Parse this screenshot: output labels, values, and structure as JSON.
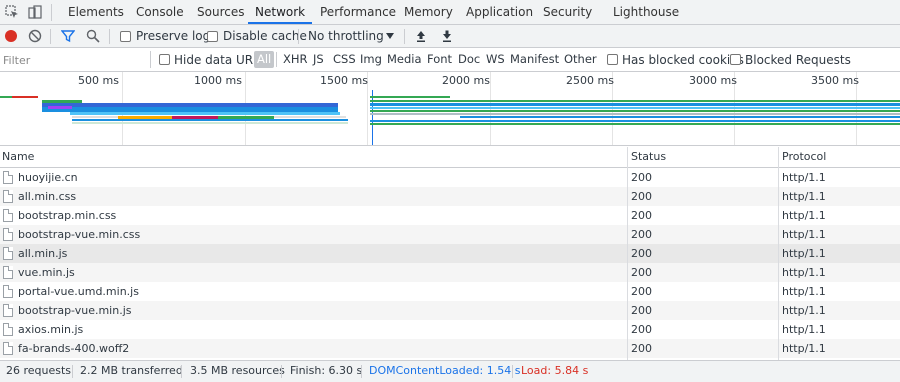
{
  "tabs": [
    "Elements",
    "Console",
    "Sources",
    "Network",
    "Performance",
    "Memory",
    "Application",
    "Security",
    "Lighthouse"
  ],
  "active_tab": "Network",
  "toolbar": {
    "preserve_log": "Preserve log",
    "disable_cache": "Disable cache",
    "throttling": "No throttling"
  },
  "filterbar": {
    "placeholder": "Filter",
    "hide_data_urls": "Hide data URLs",
    "types": [
      "All",
      "XHR",
      "JS",
      "CSS",
      "Img",
      "Media",
      "Font",
      "Doc",
      "WS",
      "Manifest",
      "Other"
    ],
    "active_type": "All",
    "has_blocked_cookies": "Has blocked cookies",
    "blocked_requests": "Blocked Requests"
  },
  "overview": {
    "ticks": [
      "500 ms",
      "1000 ms",
      "1500 ms",
      "2000 ms",
      "2500 ms",
      "3000 ms",
      "3500 ms"
    ]
  },
  "table": {
    "headers": [
      "Name",
      "Status",
      "Protocol"
    ],
    "rows": [
      {
        "name": "huoyijie.cn",
        "status": "200",
        "protocol": "http/1.1"
      },
      {
        "name": "all.min.css",
        "status": "200",
        "protocol": "http/1.1"
      },
      {
        "name": "bootstrap.min.css",
        "status": "200",
        "protocol": "http/1.1"
      },
      {
        "name": "bootstrap-vue.min.css",
        "status": "200",
        "protocol": "http/1.1"
      },
      {
        "name": "all.min.js",
        "status": "200",
        "protocol": "http/1.1"
      },
      {
        "name": "vue.min.js",
        "status": "200",
        "protocol": "http/1.1"
      },
      {
        "name": "portal-vue.umd.min.js",
        "status": "200",
        "protocol": "http/1.1"
      },
      {
        "name": "bootstrap-vue.min.js",
        "status": "200",
        "protocol": "http/1.1"
      },
      {
        "name": "axios.min.js",
        "status": "200",
        "protocol": "http/1.1"
      },
      {
        "name": "fa-brands-400.woff2",
        "status": "200",
        "protocol": "http/1.1"
      }
    ]
  },
  "statusbar": {
    "requests": "26 requests",
    "transferred": "2.2 MB transferred",
    "resources": "3.5 MB resources",
    "finish": "Finish: 6.30 s",
    "dom_content_loaded": "DOMContentLoaded: 1.54 s",
    "load": "Load: 5.84 s"
  },
  "colors": {
    "accent": "#1a73e8",
    "record": "#d93025",
    "dcl": "#1a73e8",
    "load": "#d93025"
  }
}
